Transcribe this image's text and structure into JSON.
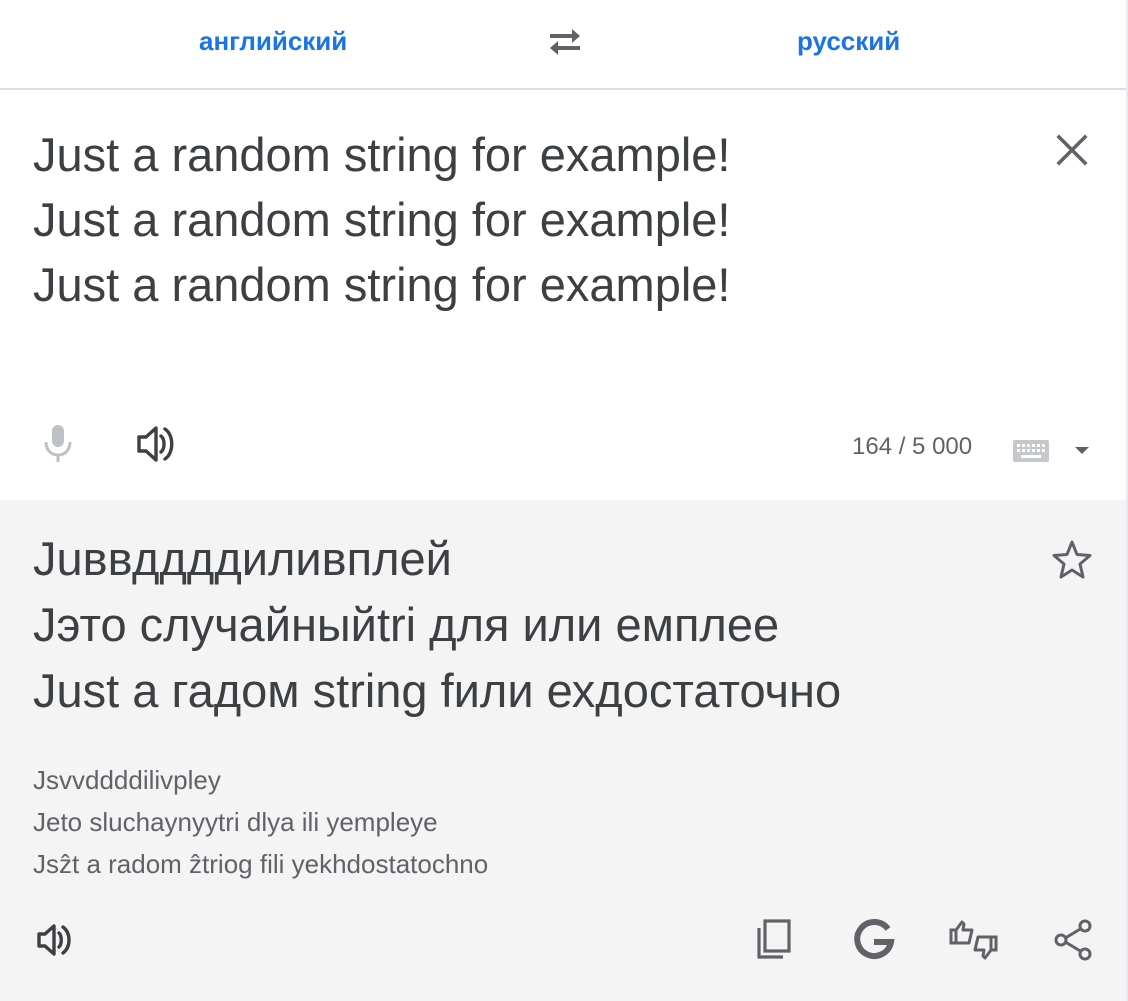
{
  "languages": {
    "source": "английский",
    "target": "русский"
  },
  "source": {
    "lines": [
      "Just a random string for example!",
      "Just a random string for example!",
      "Just a random string for example!"
    ],
    "char_count": "164 / 5 000"
  },
  "target": {
    "lines": [
      "Juввддддиливплей",
      "Jэто случайныйtri для или емплее",
      "Just a гадом string fили ехдостаточно"
    ],
    "transliteration": [
      "Jsvvddddilivpley",
      "Jeto sluchaynyytri dlya ili yempleye",
      "Jsẑt a radom ẑtriog fili yekhdostatochno"
    ]
  },
  "icons": {
    "swap": "swap-arrows-icon",
    "clear": "close-icon",
    "mic": "microphone-icon",
    "speaker": "speaker-icon",
    "keyboard": "keyboard-icon",
    "dropdown": "caret-down-icon",
    "star": "star-outline-icon",
    "copy": "copy-icon",
    "google": "google-g-icon",
    "feedback": "thumbs-feedback-icon",
    "share": "share-icon"
  },
  "colors": {
    "accent": "#1a73e8",
    "text": "#3c4043",
    "muted": "#5f6368",
    "disabled": "#9aa0a6",
    "target_bg": "#f4f4f4",
    "divider": "#dadce0"
  }
}
